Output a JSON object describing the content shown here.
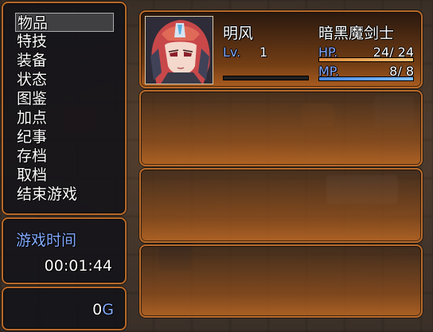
{
  "menu": {
    "items": [
      {
        "label": "物品"
      },
      {
        "label": "特技"
      },
      {
        "label": "装备"
      },
      {
        "label": "状态"
      },
      {
        "label": "图鉴"
      },
      {
        "label": "加点"
      },
      {
        "label": "纪事"
      },
      {
        "label": "存档"
      },
      {
        "label": "取档"
      },
      {
        "label": "结束游戏"
      }
    ],
    "selected_index": 0
  },
  "playtime": {
    "label": "游戏时间",
    "value": "00:01:44"
  },
  "gold": {
    "amount": "0",
    "unit": "G"
  },
  "actor": {
    "name": "明风",
    "class": "暗黑魔剑士",
    "level_label": "Lv.",
    "level": "1",
    "exp_fraction": 0.0,
    "hp_label": "HP.",
    "hp": "24",
    "hp_max": "24",
    "hp_fraction": 1.0,
    "mp_label": "MP.",
    "mp": "8",
    "mp_max": "8",
    "mp_fraction": 1.0
  },
  "colors": {
    "frame": "#b86a2a",
    "hp_gauge": [
      "#e08a3a",
      "#f0c070"
    ],
    "mp_gauge": [
      "#4a8ae0",
      "#80c0ff"
    ],
    "system_text": "#84aaff"
  }
}
